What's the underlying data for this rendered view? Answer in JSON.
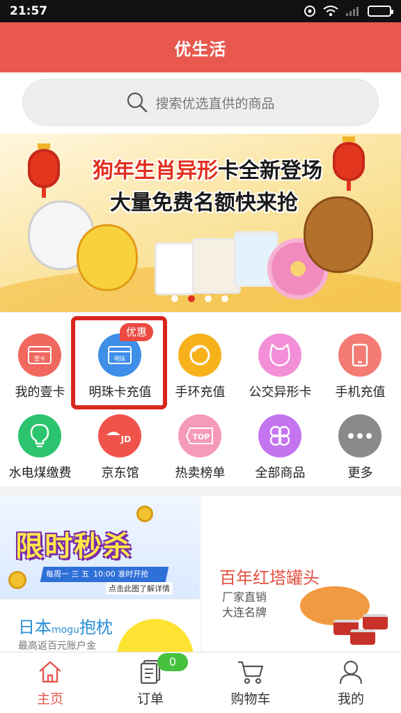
{
  "status_bar": {
    "time": "21:57"
  },
  "header": {
    "title": "优生活"
  },
  "search": {
    "placeholder": "搜索优选直供的商品"
  },
  "banner": {
    "line1_highlight": "狗年生肖异形",
    "line1_rest": "卡全新登场",
    "line2": "大量免费名额快来抢",
    "slide_count": 4,
    "active_slide": 2
  },
  "menu": {
    "highlight_tag": "优惠",
    "items": [
      {
        "label": "我的壹卡",
        "icon": "card-icon",
        "icon_text": "壹卡",
        "color": "#f0685e"
      },
      {
        "label": "明珠卡充值",
        "icon": "card-icon",
        "icon_text": "明珠",
        "color": "#3f8fe8"
      },
      {
        "label": "手环充值",
        "icon": "wristband-icon",
        "color": "#f7b21b"
      },
      {
        "label": "公交异形卡",
        "icon": "cat-card-icon",
        "color": "#f28fd8"
      },
      {
        "label": "手机充值",
        "icon": "phone-icon",
        "color": "#f37b73"
      },
      {
        "label": "水电煤缴费",
        "icon": "bulb-icon",
        "color": "#2cc46e"
      },
      {
        "label": "京东馆",
        "icon": "jd-icon",
        "icon_text": "JD",
        "color": "#f0534a"
      },
      {
        "label": "热卖榜单",
        "icon": "top-tag-icon",
        "icon_text": "TOP",
        "color": "#f59ab8"
      },
      {
        "label": "全部商品",
        "icon": "clover-icon",
        "color": "#c474ef"
      },
      {
        "label": "更多",
        "icon": "more-icon",
        "color": "#8a8a8a"
      }
    ]
  },
  "promos": {
    "flash": {
      "title": "限时秒杀",
      "schedule": "每周一 三 五",
      "time": "10:00 准时开抢",
      "cta": "点击此图了解详情"
    },
    "pillow": {
      "title_a": "日本",
      "title_b": "mogu",
      "title_c": "抱枕",
      "subtitle": "最高返百元账户金"
    },
    "cans": {
      "title": "百年红塔罐头",
      "sub1": "厂家直销",
      "sub2": "大连名牌"
    }
  },
  "bottom_nav": {
    "cart_count": "0",
    "items": [
      {
        "label": "主页",
        "icon": "home-icon"
      },
      {
        "label": "订单",
        "icon": "order-icon"
      },
      {
        "label": "购物车",
        "icon": "cart-icon"
      },
      {
        "label": "我的",
        "icon": "user-icon"
      }
    ]
  }
}
